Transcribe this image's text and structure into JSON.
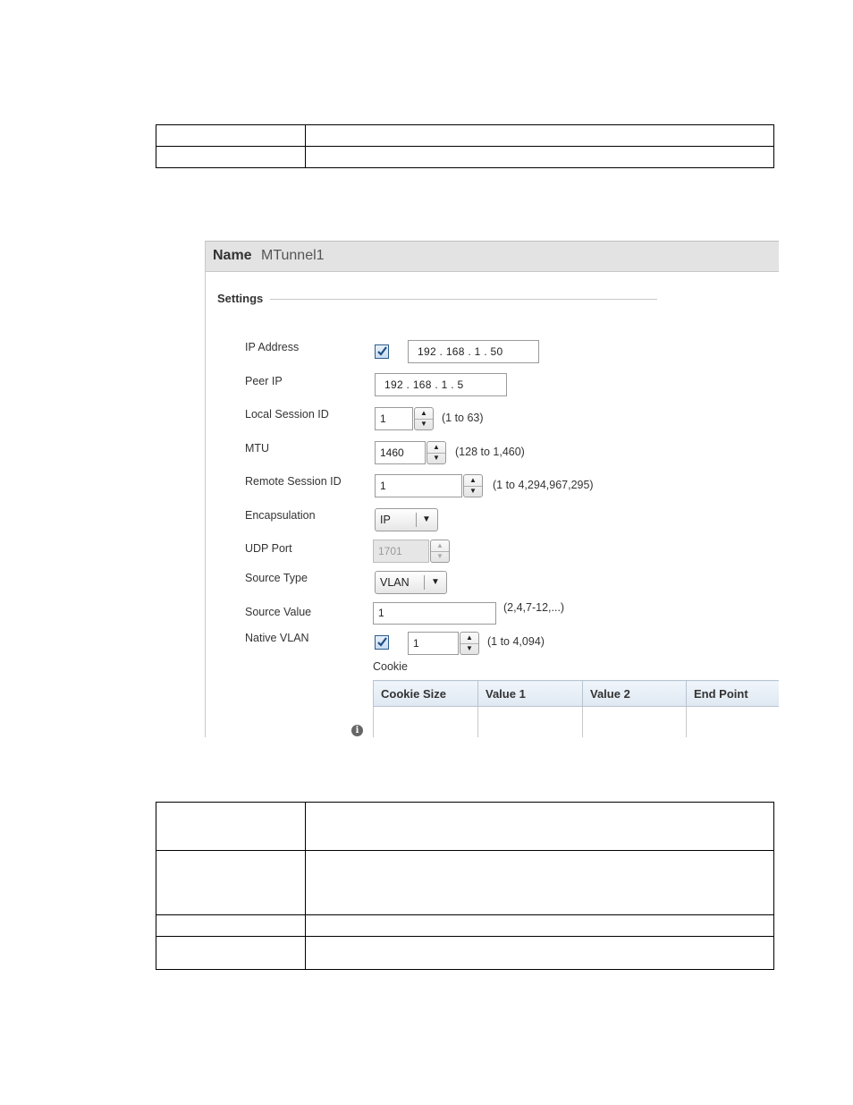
{
  "panel": {
    "name_label": "Name",
    "name_value": "MTunnel1",
    "settings_label": "Settings"
  },
  "fields": {
    "ip_address": {
      "label": "IP Address",
      "checked": true,
      "value": "192 .  168 .    1   .   50"
    },
    "peer_ip": {
      "label": "Peer IP",
      "value": "192 .  168 .    1   .    5"
    },
    "local_session_id": {
      "label": "Local Session ID",
      "value": "1",
      "hint": "(1 to 63)"
    },
    "mtu": {
      "label": "MTU",
      "value": "1460",
      "hint": "(128 to 1,460)"
    },
    "remote_session_id": {
      "label": "Remote Session ID",
      "value": "1",
      "hint": "(1 to 4,294,967,295)"
    },
    "encapsulation": {
      "label": "Encapsulation",
      "value": "IP"
    },
    "udp_port": {
      "label": "UDP Port",
      "value": "1701"
    },
    "source_type": {
      "label": "Source Type",
      "value": "VLAN"
    },
    "source_value": {
      "label": "Source Value",
      "value": "1",
      "hint": "(2,4,7-12,...)"
    },
    "native_vlan": {
      "label": "Native VLAN",
      "checked": true,
      "value": "1",
      "hint": "(1 to 4,094)"
    }
  },
  "cookie": {
    "label": "Cookie",
    "columns": [
      "Cookie Size",
      "Value 1",
      "Value 2",
      "End Point"
    ]
  },
  "icons": {
    "check": "checkmark-icon",
    "spin_up": "▲",
    "spin_down": "▼",
    "dropdown": "▼",
    "info": "i"
  }
}
